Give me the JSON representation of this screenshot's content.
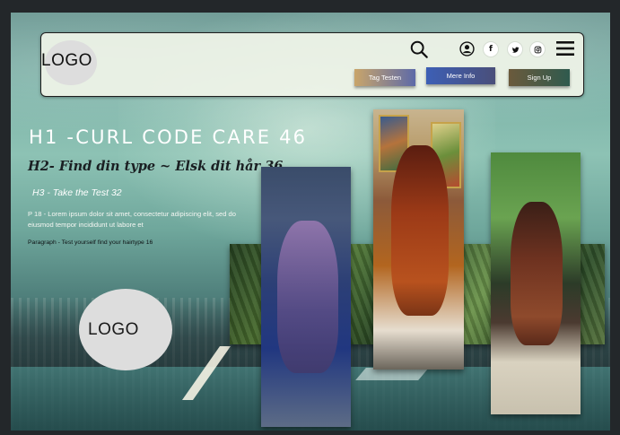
{
  "header": {
    "logo_text": "LOGO",
    "icons": [
      "search-icon",
      "user-icon",
      "facebook-icon",
      "twitter-icon",
      "instagram-icon",
      "menu-icon"
    ],
    "social": {
      "facebook": "f",
      "twitter": "t",
      "instagram": "ig"
    },
    "buttons": {
      "test": "Tag Testen",
      "info": "Mere Info",
      "signup": "Sign Up"
    }
  },
  "hero": {
    "h1": "H1 -CURL  CODE  CARE 46",
    "h2": "H2- Find din type ~ Elsk dit hår 36",
    "h3": "H3 - Take the Test 32",
    "p18": "P 18 - Lorem ipsum dolor sit amet, consectetur adipiscing elit, sed do eiusmod tempor incididunt ut labore et",
    "paragraph": "Paragraph - Test yourself find your hairtype 16"
  },
  "logo_big": {
    "text": "LOGO"
  },
  "colors": {
    "header_bg": "#f0f4e8",
    "btn_test": "#c9a56a",
    "btn_info": "#3d5fb5",
    "btn_signup": "#2f5a4e",
    "h1_text": "#ffffff",
    "h2_text": "#1a1f22"
  }
}
